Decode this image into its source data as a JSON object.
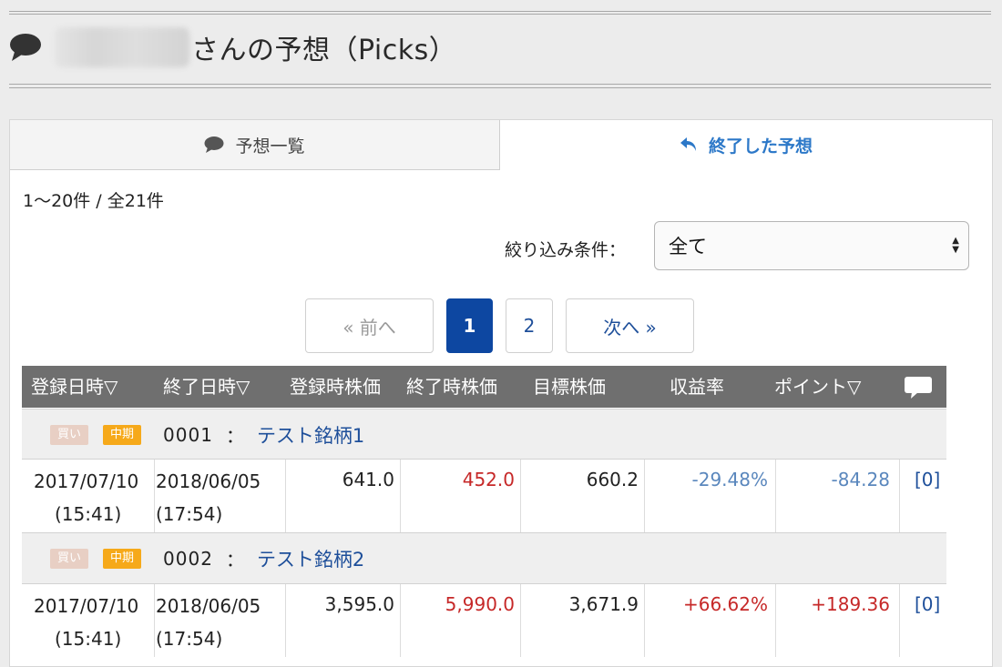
{
  "header": {
    "title": "さんの予想（Picks）"
  },
  "tabs": [
    {
      "label": "予想一覧",
      "icon": "speech-bubble-icon"
    },
    {
      "label": "終了した予想",
      "icon": "reply-arrow-icon"
    }
  ],
  "summary": {
    "count": "1〜20件 / 全21件"
  },
  "filter": {
    "label": "絞り込み条件：",
    "value": "全て"
  },
  "pagination": {
    "prev": "« 前へ",
    "pages": [
      "1",
      "2"
    ],
    "next": "次へ »"
  },
  "table": {
    "columns": [
      "登録日時▽",
      "終了日時▽",
      "登録時株価",
      "終了時株価",
      "目標株価",
      "収益率",
      "ポイント▽"
    ],
    "rows": [
      {
        "badge_buy": "買い",
        "badge_term": "中期",
        "code": "0001",
        "sep": "：",
        "name": "テスト銘柄1",
        "reg_date": "2017/07/10",
        "reg_time": "(15:41)",
        "end_date": "2018/06/05",
        "end_time": "(17:54)",
        "reg_price": "641.0",
        "end_price": "452.0",
        "target": "660.2",
        "return": "-29.48%",
        "points": "-84.28",
        "comments": "[0]"
      },
      {
        "badge_buy": "買い",
        "badge_term": "中期",
        "code": "0002",
        "sep": "：",
        "name": "テスト銘柄2",
        "reg_date": "2017/07/10",
        "reg_time": "(15:41)",
        "end_date": "2018/06/05",
        "end_time": "(17:54)",
        "reg_price": "3,595.0",
        "end_price": "5,990.0",
        "target": "3,671.9",
        "return": "+66.62%",
        "points": "+189.36",
        "comments": "[0]"
      }
    ]
  },
  "colors": {
    "active_page": "#0d47a1",
    "link": "#1e4f9a",
    "negative": "#5a87bd",
    "positive": "#c62828",
    "header_bg": "#6f6f6f"
  }
}
